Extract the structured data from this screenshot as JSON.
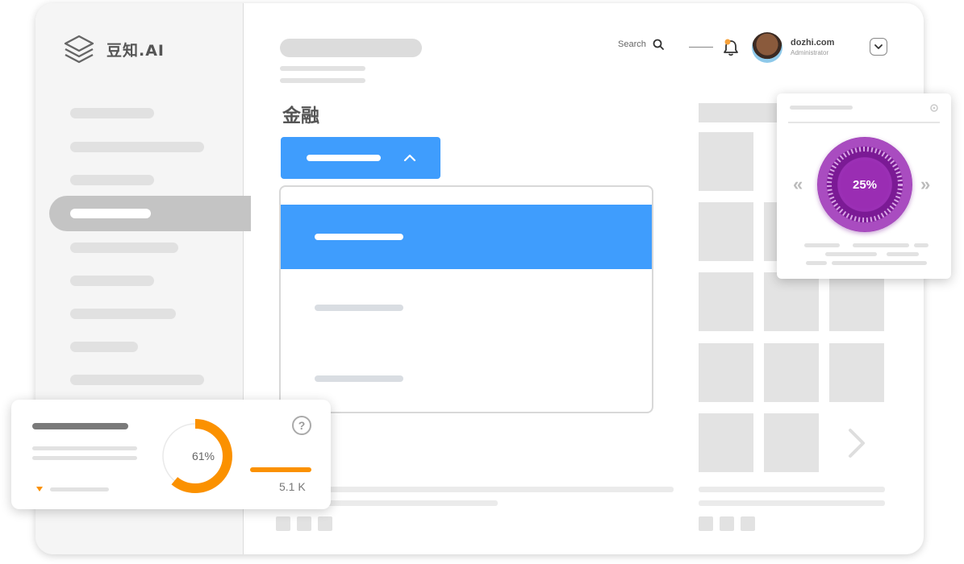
{
  "app": {
    "brand": "豆知.AI"
  },
  "header": {
    "search_label": "Search",
    "user": {
      "name": "dozhi.com",
      "role": "Administrator"
    }
  },
  "main": {
    "section_title": "金融"
  },
  "dropdown": {
    "selected_index": 0,
    "expanded": true,
    "item_count": 3
  },
  "progress_widget": {
    "value_label": "25%",
    "value": 0.25
  },
  "stats_card": {
    "donut_label": "61%",
    "donut_value": 0.61,
    "stat_value": "5.1 K",
    "help_label": "?"
  },
  "colors": {
    "accent_blue": "#3f9dfd",
    "orange": "#fb9100",
    "purple": "#8b26a6"
  },
  "icons": [
    "layers-logo-icon",
    "search-icon",
    "bell-icon",
    "chevron-down-icon",
    "chevron-up-icon",
    "chevron-right-icon",
    "settings-icon",
    "help-icon",
    "triangle-down-icon"
  ]
}
